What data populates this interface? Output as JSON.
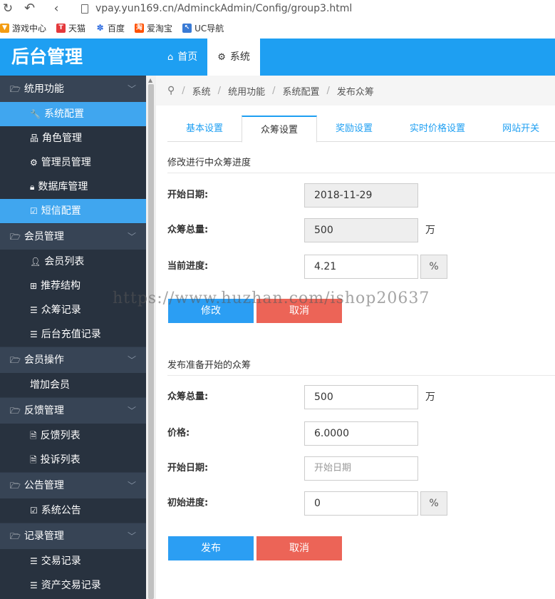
{
  "browser": {
    "url": "vpay.yun169.cn/AdminckAdmin/Config/group3.html",
    "bookmarks": [
      {
        "label": "游戏中心",
        "color": "#f39c12"
      },
      {
        "label": "天猫",
        "icon_text": "T",
        "color": "#e4393c"
      },
      {
        "label": "百度",
        "color": "#2f6de1"
      },
      {
        "label": "爱淘宝",
        "icon_text": "淘",
        "color": "#ff5000"
      },
      {
        "label": "UC导航",
        "color": "#3a7bd5"
      }
    ]
  },
  "header": {
    "brand": "后台管理",
    "nav": [
      {
        "label": "首页",
        "icon": "home-icon"
      },
      {
        "label": "系统",
        "icon": "gear-icon"
      }
    ]
  },
  "sidebar": {
    "groups": [
      {
        "label": "统用功能",
        "items": [
          {
            "label": "系统配置",
            "icon": "wrench-icon",
            "active": true
          },
          {
            "label": "角色管理",
            "icon": "sitemap-icon"
          },
          {
            "label": "管理员管理",
            "icon": "gear-icon"
          },
          {
            "label": "数据库管理",
            "icon": "lock-icon"
          },
          {
            "label": "短信配置",
            "icon": "edit-icon",
            "active": true
          }
        ]
      },
      {
        "label": "会员管理",
        "items": [
          {
            "label": "会员列表",
            "icon": "user-icon"
          },
          {
            "label": "推荐结构",
            "icon": "grid-icon"
          },
          {
            "label": "众筹记录",
            "icon": "list-icon"
          },
          {
            "label": "后台充值记录",
            "icon": "list-icon"
          }
        ]
      },
      {
        "label": "会员操作",
        "items": [
          {
            "label": "增加会员",
            "icon": ""
          }
        ]
      },
      {
        "label": "反馈管理",
        "items": [
          {
            "label": "反馈列表",
            "icon": "file-icon"
          },
          {
            "label": "投诉列表",
            "icon": "file-icon"
          }
        ]
      },
      {
        "label": "公告管理",
        "items": [
          {
            "label": "系统公告",
            "icon": "edit-icon"
          }
        ]
      },
      {
        "label": "记录管理",
        "items": [
          {
            "label": "交易记录",
            "icon": "list-icon"
          },
          {
            "label": "资产交易记录",
            "icon": "list-icon"
          }
        ]
      }
    ]
  },
  "breadcrumb": [
    "系统",
    "统用功能",
    "系统配置",
    "发布众筹"
  ],
  "tabs": [
    "基本设置",
    "众筹设置",
    "奖励设置",
    "实时价格设置",
    "网站开关"
  ],
  "active_tab": "众筹设置",
  "section1": {
    "title": "修改进行中众筹进度",
    "start_date_label": "开始日期:",
    "start_date_value": "2018-11-29",
    "total_label": "众筹总量:",
    "total_value": "500",
    "total_unit": "万",
    "progress_label": "当前进度:",
    "progress_value": "4.21",
    "progress_unit": "%",
    "submit_label": "修改",
    "cancel_label": "取消"
  },
  "section2": {
    "title": "发布准备开始的众筹",
    "total_label": "众筹总量:",
    "total_value": "500",
    "total_unit": "万",
    "price_label": "价格:",
    "price_value": "6.0000",
    "start_date_label": "开始日期:",
    "start_date_placeholder": "开始日期",
    "init_progress_label": "初始进度:",
    "init_progress_value": "0",
    "init_progress_unit": "%",
    "submit_label": "发布",
    "cancel_label": "取消"
  },
  "watermark": "https://www.huzhan.com/ishop20637"
}
